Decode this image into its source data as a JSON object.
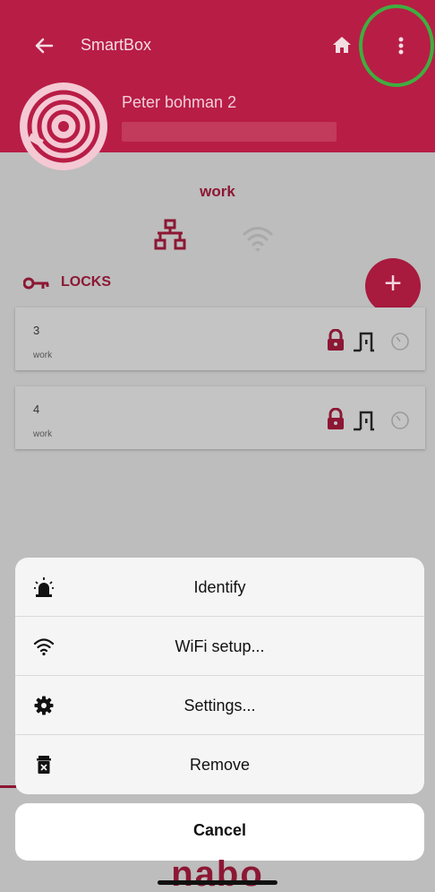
{
  "header": {
    "title": "SmartBox",
    "device_name": "Peter bohman 2",
    "color": "#b81d46"
  },
  "hub": {
    "network_label": "work",
    "connection_icons": [
      "ethernet-network-icon",
      "wifi-icon"
    ]
  },
  "locks_section": {
    "label": "LOCKS",
    "add_button": "+"
  },
  "locks": [
    {
      "number": "3",
      "network": "work"
    },
    {
      "number": "4",
      "network": "work"
    }
  ],
  "action_sheet": {
    "items": [
      {
        "label": "Identify",
        "icon": "siren-icon"
      },
      {
        "label": "WiFi setup...",
        "icon": "wifi-icon"
      },
      {
        "label": "Settings...",
        "icon": "gear-icon"
      },
      {
        "label": "Remove",
        "icon": "trash-icon"
      }
    ],
    "cancel": "Cancel"
  },
  "brand": "nabo"
}
